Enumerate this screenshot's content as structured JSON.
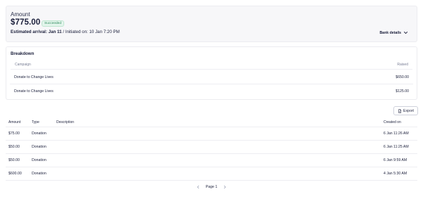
{
  "summary": {
    "amount_label": "Amount",
    "amount_value": "$775.00",
    "status_badge": "Succeeded",
    "arrival_prefix": "Estimated arrival: Jan 11",
    "initiated_text": " / Initiated on: 10 Jan 7:20 PM",
    "bank_details_label": "Bank details"
  },
  "breakdown": {
    "title": "Breakdown",
    "columns": [
      "Campaign",
      "Raised"
    ],
    "rows": [
      {
        "campaign": "Donate to Change Lives",
        "raised": "$650.00"
      },
      {
        "campaign": "Donate to Change Lives",
        "raised": "$125.00"
      }
    ]
  },
  "transactions": {
    "export_label": "Export",
    "columns": {
      "amount": "Amount",
      "type": "Type",
      "description": "Description",
      "created_on": "Created on"
    },
    "rows": [
      {
        "amount": "$75.00",
        "type": "Donation",
        "description": "",
        "created_on": "6 Jan 11:26 AM"
      },
      {
        "amount": "$50.00",
        "type": "Donation",
        "description": "",
        "created_on": "6 Jan 11:25 AM"
      },
      {
        "amount": "$50.00",
        "type": "Donation",
        "description": "",
        "created_on": "6 Jan 9:59 AM"
      },
      {
        "amount": "$600.00",
        "type": "Donation",
        "description": "",
        "created_on": "4 Jan 5:30 AM"
      }
    ]
  },
  "pagination": {
    "label": "Page 1"
  },
  "icons": {
    "chevron": "chevron-down-icon",
    "export": "file-icon",
    "prev": "chevron-left-icon",
    "next": "chevron-right-icon"
  },
  "colors": {
    "success_bg": "#e3f5ec",
    "success_text": "#2d8a5c",
    "text_primary": "#1b1f3b",
    "muted": "#7a7f96"
  }
}
